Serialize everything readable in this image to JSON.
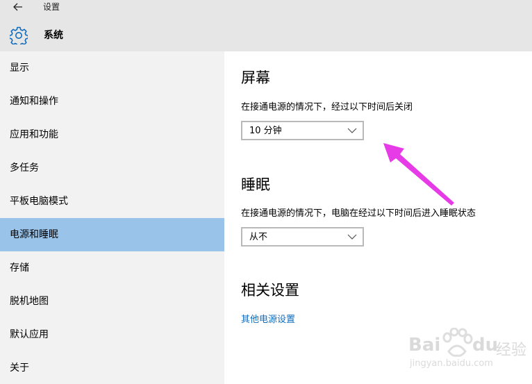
{
  "window": {
    "title": "设置"
  },
  "header": {
    "section_title": "系统",
    "icon": "gear-icon"
  },
  "sidebar": {
    "items": [
      {
        "label": "显示",
        "selected": false
      },
      {
        "label": "通知和操作",
        "selected": false
      },
      {
        "label": "应用和功能",
        "selected": false
      },
      {
        "label": "多任务",
        "selected": false
      },
      {
        "label": "平板电脑模式",
        "selected": false
      },
      {
        "label": "电源和睡眠",
        "selected": true
      },
      {
        "label": "存储",
        "selected": false
      },
      {
        "label": "脱机地图",
        "selected": false
      },
      {
        "label": "默认应用",
        "selected": false
      },
      {
        "label": "关于",
        "selected": false
      }
    ]
  },
  "screen": {
    "heading": "屏幕",
    "description": "在接通电源的情况下，经过以下时间后关闭",
    "selected_value": "10 分钟"
  },
  "sleep": {
    "heading": "睡眠",
    "description": "在接通电源的情况下，电脑在经过以下时间后进入睡眠状态",
    "selected_value": "从不"
  },
  "related": {
    "heading": "相关设置",
    "link": "其他电源设置"
  },
  "watermark": {
    "brand": "Bai",
    "brand2": "du",
    "product": "经验",
    "url": "jingyan.baidu.com"
  },
  "colors": {
    "selected_bg": "#99c3e8",
    "sidebar_bg": "#f2f2f2",
    "titlebar_bg": "#e6e6e6",
    "accent": "#0f6cbd",
    "annotation_arrow": "#e63be6"
  }
}
